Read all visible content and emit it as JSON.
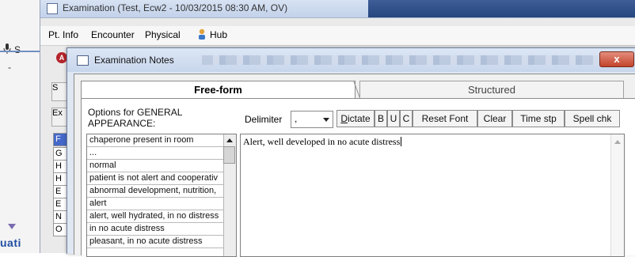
{
  "background_window": {
    "title": "Examination (Test, Ecw2  - 10/03/2015  08:30 AM, OV)",
    "menu": [
      "Pt. Info",
      "Encounter",
      "Physical",
      "Hub"
    ],
    "left_label": "S",
    "left_partial_text": "uati",
    "side_letters": [
      "S",
      "Ex",
      "F",
      "G",
      "H",
      "H",
      "E",
      "E",
      "N",
      "O"
    ]
  },
  "dialog": {
    "title": "Examination Notes",
    "close_label": "x",
    "tabs": [
      {
        "label": "Free-form",
        "active": true
      },
      {
        "label": "Structured",
        "active": false
      }
    ],
    "options_label": "Options for GENERAL APPEARANCE:",
    "delimiter_label": "Delimiter",
    "delimiter_value": ",",
    "toolbar": [
      "Dictate",
      "B",
      "U",
      "C",
      "Reset Font",
      "Clear",
      "Time stp",
      "Spell chk"
    ],
    "options": [
      "chaperone present in room",
      "...",
      "normal",
      "patient is not alert and cooperativ",
      "abnormal development, nutrition,",
      "alert",
      "alert, well hydrated, in no distress",
      "in no acute distress",
      "pleasant, in no acute distress"
    ],
    "notes_text": "Alert, well developed in no acute distress"
  },
  "colors": {
    "title_bar": "#c8d6ec",
    "close_button": "#c2442b",
    "dark_title": "#25467f",
    "link_blue": "#1f4ea3"
  }
}
